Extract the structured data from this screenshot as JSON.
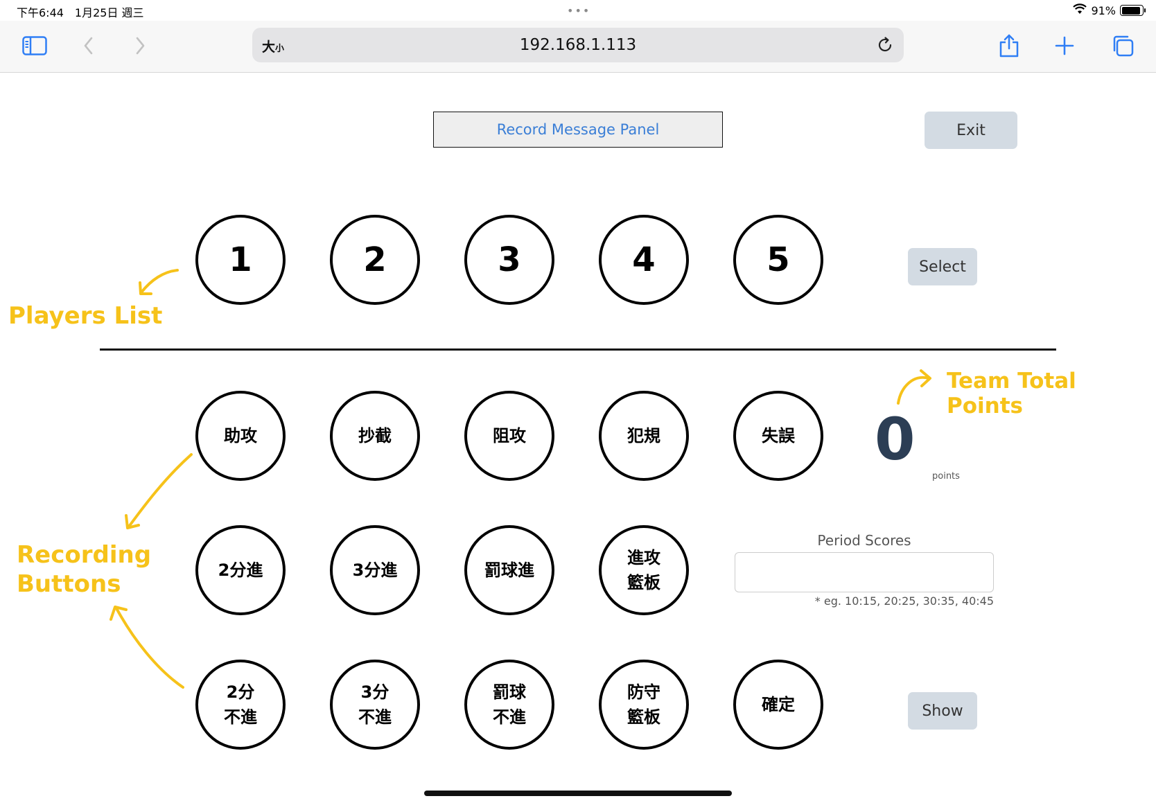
{
  "status_bar": {
    "time": "下午6:44　1月25日 週三",
    "dots": "•••",
    "battery": "91%",
    "battery_level": 0.91
  },
  "browser": {
    "size_label": "大",
    "size_label_small": "小",
    "url": "192.168.1.113",
    "icons": {
      "sidebar": "sidebar-icon",
      "back": "chevron-left-icon",
      "forward": "chevron-right-icon",
      "reload": "reload-icon",
      "share": "share-icon",
      "new_tab": "plus-icon",
      "tabs": "tabs-icon"
    }
  },
  "header": {
    "record_panel": "Record Message Panel",
    "exit_label": "Exit"
  },
  "players": {
    "numbers": [
      "1",
      "2",
      "3",
      "4",
      "5"
    ],
    "select_label": "Select"
  },
  "actions": {
    "row1": [
      "助攻",
      "抄截",
      "阻攻",
      "犯規",
      "失誤"
    ],
    "row2": [
      "2分進",
      "3分進",
      "罰球進",
      "進攻\n籃板"
    ],
    "row3": [
      "2分\n不進",
      "3分\n不進",
      "罰球\n不進",
      "防守\n籃板",
      "確定"
    ]
  },
  "score": {
    "total": "0",
    "unit": "points"
  },
  "period": {
    "label": "Period Scores",
    "value": "",
    "hint": "* eg. 10:15, 20:25, 30:35, 40:45"
  },
  "show_label": "Show",
  "annotations": {
    "players_list": "Players List",
    "team_total_points": "Team Total Points",
    "recording_line1": "Recording",
    "recording_line2": "Buttons",
    "color": "#f6c21a"
  },
  "colors": {
    "link_blue": "#3a7ed6",
    "button_gray": "#d3dbe3",
    "score_navy": "#2c3e55"
  }
}
